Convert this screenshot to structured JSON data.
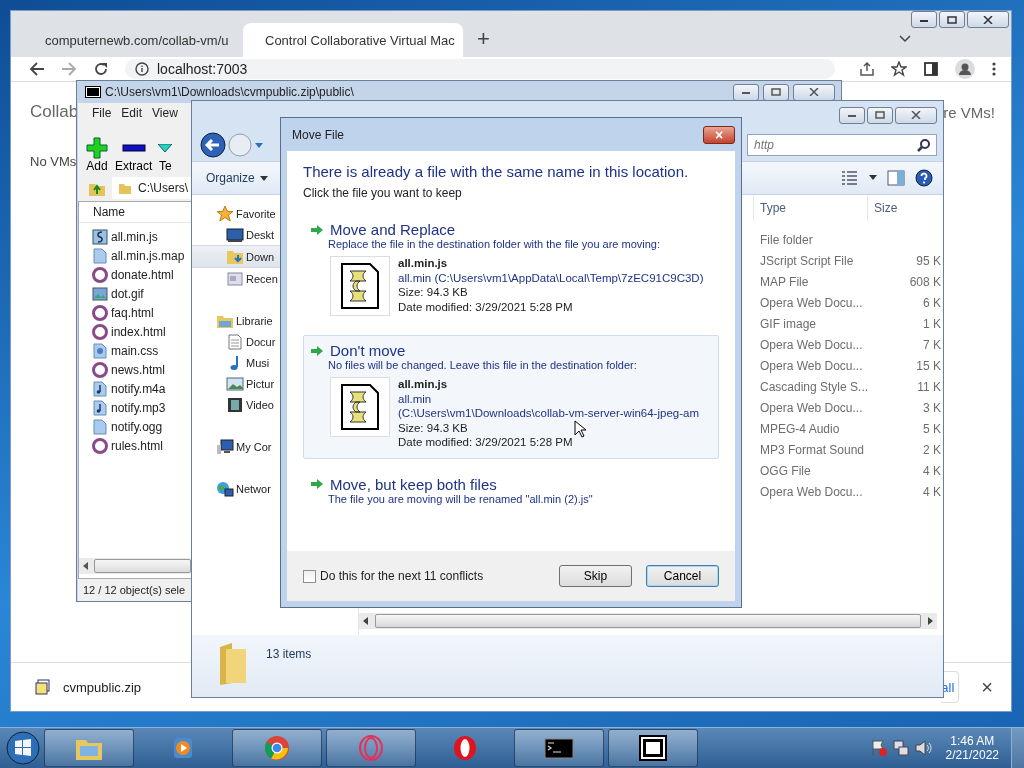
{
  "browser": {
    "tabs": [
      {
        "title": "computernewb.com/collab-vm/u",
        "selected": false
      },
      {
        "title": "Control Collaborative Virtual Mac",
        "selected": true
      }
    ],
    "new_tab": "+",
    "address": "localhost:7003",
    "page": {
      "heading": "Collab",
      "message": "No VMs",
      "link": "re VMs!"
    },
    "download_bar": {
      "file": "cvmpublic.zip",
      "show_all": "all",
      "close": "×"
    }
  },
  "archive_window": {
    "title": "C:\\Users\\vm1\\Downloads\\cvmpublic.zip\\public\\",
    "menu": [
      "File",
      "Edit",
      "View"
    ],
    "toolbar": [
      {
        "label": "Add",
        "kind": "add"
      },
      {
        "label": "Extract",
        "kind": "extract"
      },
      {
        "label": "Te",
        "kind": "test"
      }
    ],
    "path": "C:\\Users\\",
    "column": "Name",
    "files": [
      {
        "name": "all.min.js",
        "kind": "script"
      },
      {
        "name": "all.min.js.map",
        "kind": "file"
      },
      {
        "name": "donate.html",
        "kind": "html"
      },
      {
        "name": "dot.gif",
        "kind": "image"
      },
      {
        "name": "faq.html",
        "kind": "html"
      },
      {
        "name": "index.html",
        "kind": "html"
      },
      {
        "name": "main.css",
        "kind": "css"
      },
      {
        "name": "news.html",
        "kind": "html"
      },
      {
        "name": "notify.m4a",
        "kind": "audio"
      },
      {
        "name": "notify.mp3",
        "kind": "audio"
      },
      {
        "name": "notify.ogg",
        "kind": "file"
      },
      {
        "name": "rules.html",
        "kind": "html"
      }
    ],
    "status": "12 / 12 object(s) sele"
  },
  "explorer": {
    "search_placeholder": "http",
    "organize": "Organize",
    "nav": [
      {
        "label": "Favorite",
        "kind": "star",
        "selected": false,
        "children": [
          {
            "label": "Deskt",
            "kind": "desktop",
            "selected": false
          },
          {
            "label": "Down",
            "kind": "downloads",
            "selected": true
          },
          {
            "label": "Recen",
            "kind": "recent",
            "selected": false
          }
        ]
      },
      {
        "label": "Librarie",
        "kind": "libraries",
        "selected": false,
        "children": [
          {
            "label": "Docur",
            "kind": "documents",
            "selected": false
          },
          {
            "label": "Musi",
            "kind": "music",
            "selected": false
          },
          {
            "label": "Pictur",
            "kind": "pictures",
            "selected": false
          },
          {
            "label": "Video",
            "kind": "videos",
            "selected": false
          }
        ]
      },
      {
        "label": "My Cor",
        "kind": "computer",
        "selected": false
      },
      {
        "label": "Networ",
        "kind": "network",
        "selected": false
      }
    ],
    "columns": [
      "Type",
      "Size"
    ],
    "rows": [
      {
        "type": "File folder"
      },
      {
        "type": "JScript Script File",
        "size": "95 K"
      },
      {
        "type": "MAP File",
        "size": "608 K"
      },
      {
        "type": "Opera Web Docu...",
        "size": "6 K"
      },
      {
        "type": "GIF image",
        "size": "1 K"
      },
      {
        "type": "Opera Web Docu...",
        "size": "7 K"
      },
      {
        "type": "Opera Web Docu...",
        "size": "15 K"
      },
      {
        "type": "Cascading Style S...",
        "size": "11 K"
      },
      {
        "type": "Opera Web Docu...",
        "size": "3 K"
      },
      {
        "type": "MPEG-4 Audio",
        "size": "5 K"
      },
      {
        "type": "MP3 Format Sound",
        "size": "2 K"
      },
      {
        "type": "OGG File",
        "size": "4 K"
      },
      {
        "type": "Opera Web Docu...",
        "size": "4 K"
      }
    ],
    "status": "13 items"
  },
  "dialog": {
    "title": "Move File",
    "close": "×",
    "heading": "There is already a file with the same name in this location.",
    "instruction": "Click the file you want to keep",
    "options": [
      {
        "title": "Move and Replace",
        "description": "Replace the file in the destination folder with the file you are moving:",
        "selected": false,
        "file": {
          "name": "all.min.js",
          "location": [
            "all.min (C:\\Users\\vm1\\AppData\\Local\\Temp\\7zEC91C9C3D)"
          ],
          "size": "Size: 94.3 KB",
          "date": "Date modified: 3/29/2021 5:28 PM"
        }
      },
      {
        "title": "Don't move",
        "description": "No files will be changed. Leave this file in the destination folder:",
        "selected": true,
        "file": {
          "name": "all.min.js",
          "location": [
            "all.min",
            "(C:\\Users\\vm1\\Downloads\\collab-vm-server-win64-jpeg-am"
          ],
          "size": "Size: 94.3 KB",
          "date": "Date modified: 3/29/2021 5:28 PM"
        }
      },
      {
        "title": "Move, but keep both files",
        "description": "The file you are moving will be renamed \"all.min (2).js\"",
        "selected": false
      }
    ],
    "checkbox": {
      "label": "Do this for the next 11 conflicts",
      "checked": false
    },
    "buttons": [
      {
        "label": "Skip",
        "focused": false
      },
      {
        "label": "Cancel",
        "focused": true
      }
    ]
  },
  "taskbar": {
    "apps": [
      {
        "kind": "explorer",
        "selected": true
      },
      {
        "kind": "media",
        "selected": false
      },
      {
        "kind": "chrome",
        "selected": true
      },
      {
        "kind": "operagx",
        "selected": true
      },
      {
        "kind": "opera",
        "selected": false
      },
      {
        "kind": "console",
        "selected": true
      },
      {
        "kind": "sevenzip",
        "selected": true
      }
    ],
    "time": "1:46 AM",
    "date": "2/21/2022"
  }
}
